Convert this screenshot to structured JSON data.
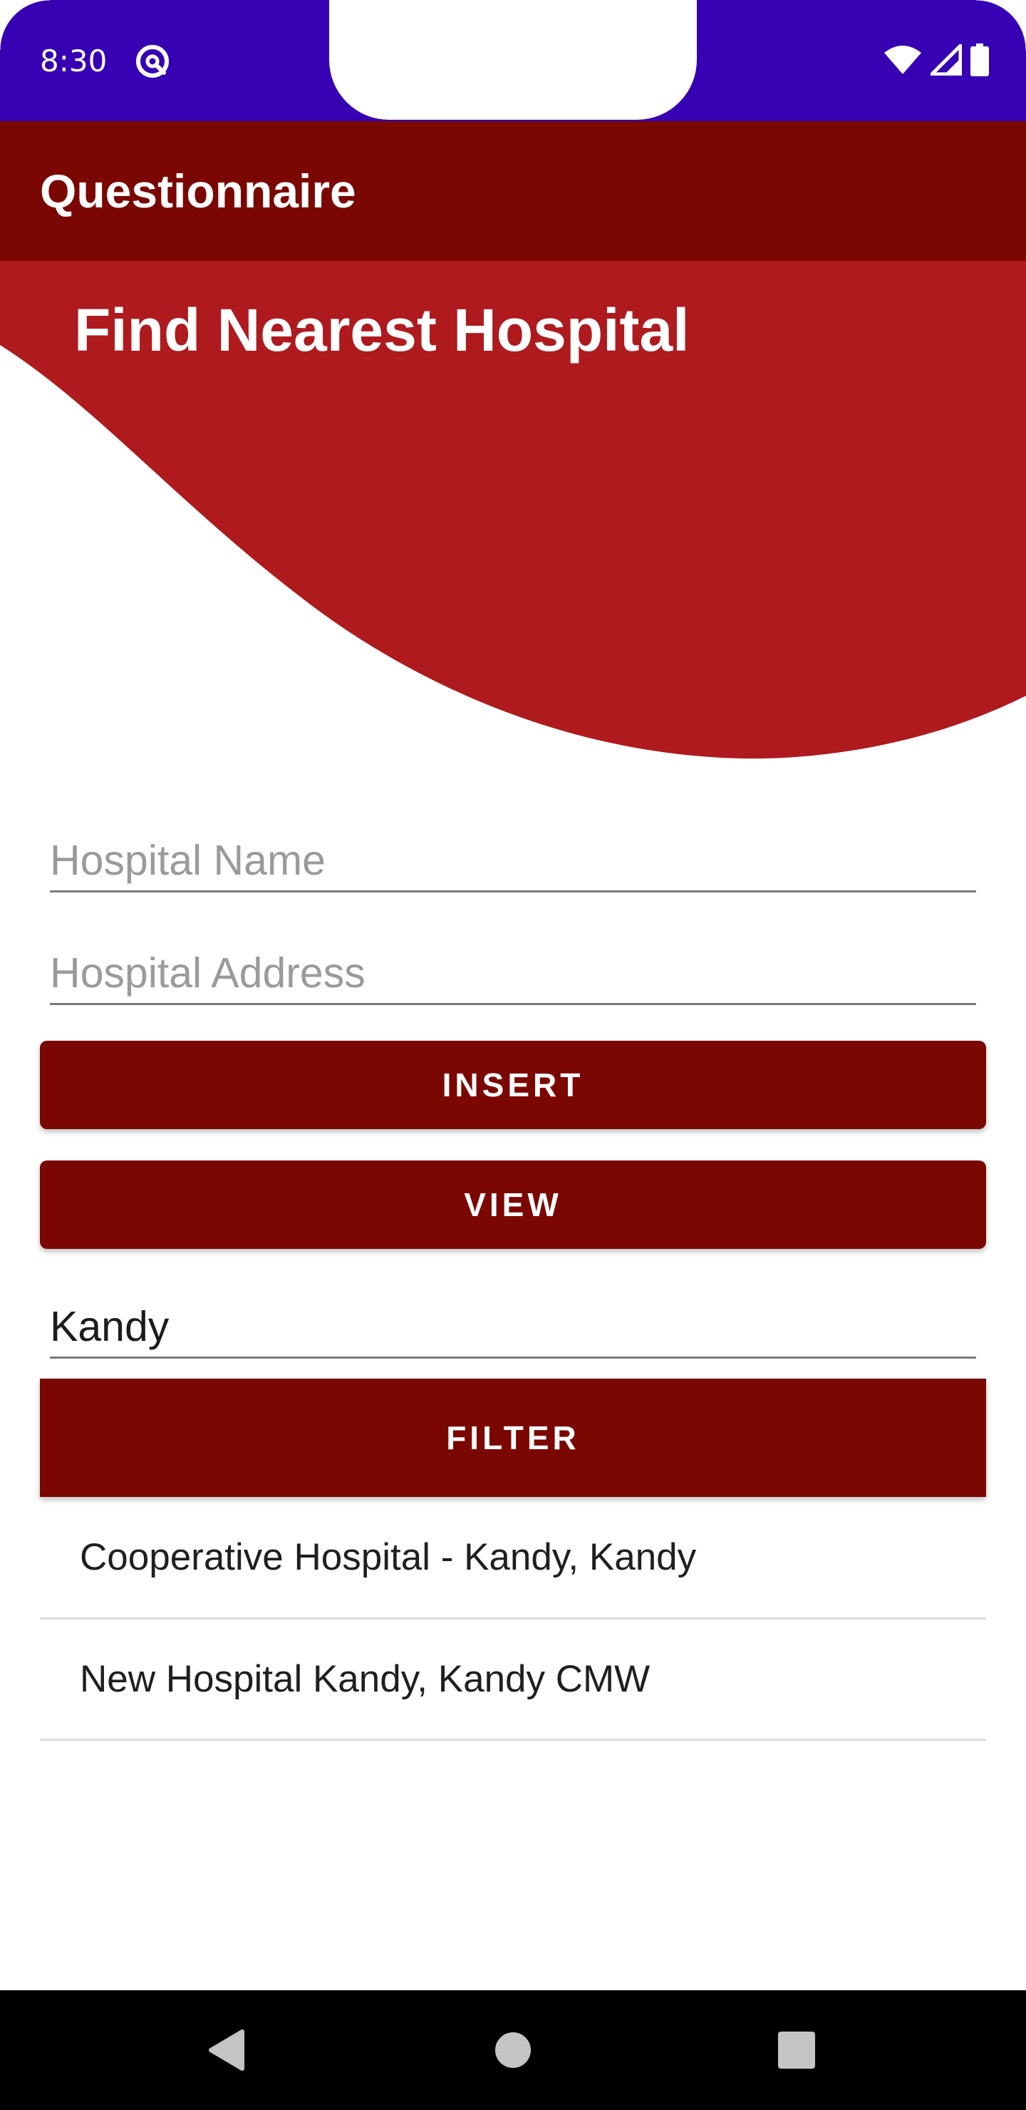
{
  "status_bar": {
    "time": "8:30",
    "app_icon": "do-not-disturb-icon",
    "icons": [
      "wifi-icon",
      "cell-signal-icon",
      "battery-icon"
    ],
    "color": "#3700b3"
  },
  "app_bar": {
    "title": "Questionnaire",
    "color": "#7b0702"
  },
  "header": {
    "title": "Find Nearest Hospital",
    "wave_color": "#ae1a1e"
  },
  "form": {
    "hospital_name": {
      "value": "",
      "placeholder": "Hospital Name"
    },
    "hospital_address": {
      "value": "",
      "placeholder": "Hospital Address"
    },
    "insert_label": "INSERT",
    "view_label": "VIEW",
    "filter_input": {
      "value": "Kandy",
      "placeholder": ""
    },
    "filter_label": "FILTER"
  },
  "results": [
    {
      "label": "Cooperative Hospital - Kandy, Kandy"
    },
    {
      "label": "New Hospital Kandy, Kandy CMW"
    }
  ],
  "nav_bar": {
    "icons": [
      "back-icon",
      "home-icon",
      "recents-icon"
    ]
  }
}
